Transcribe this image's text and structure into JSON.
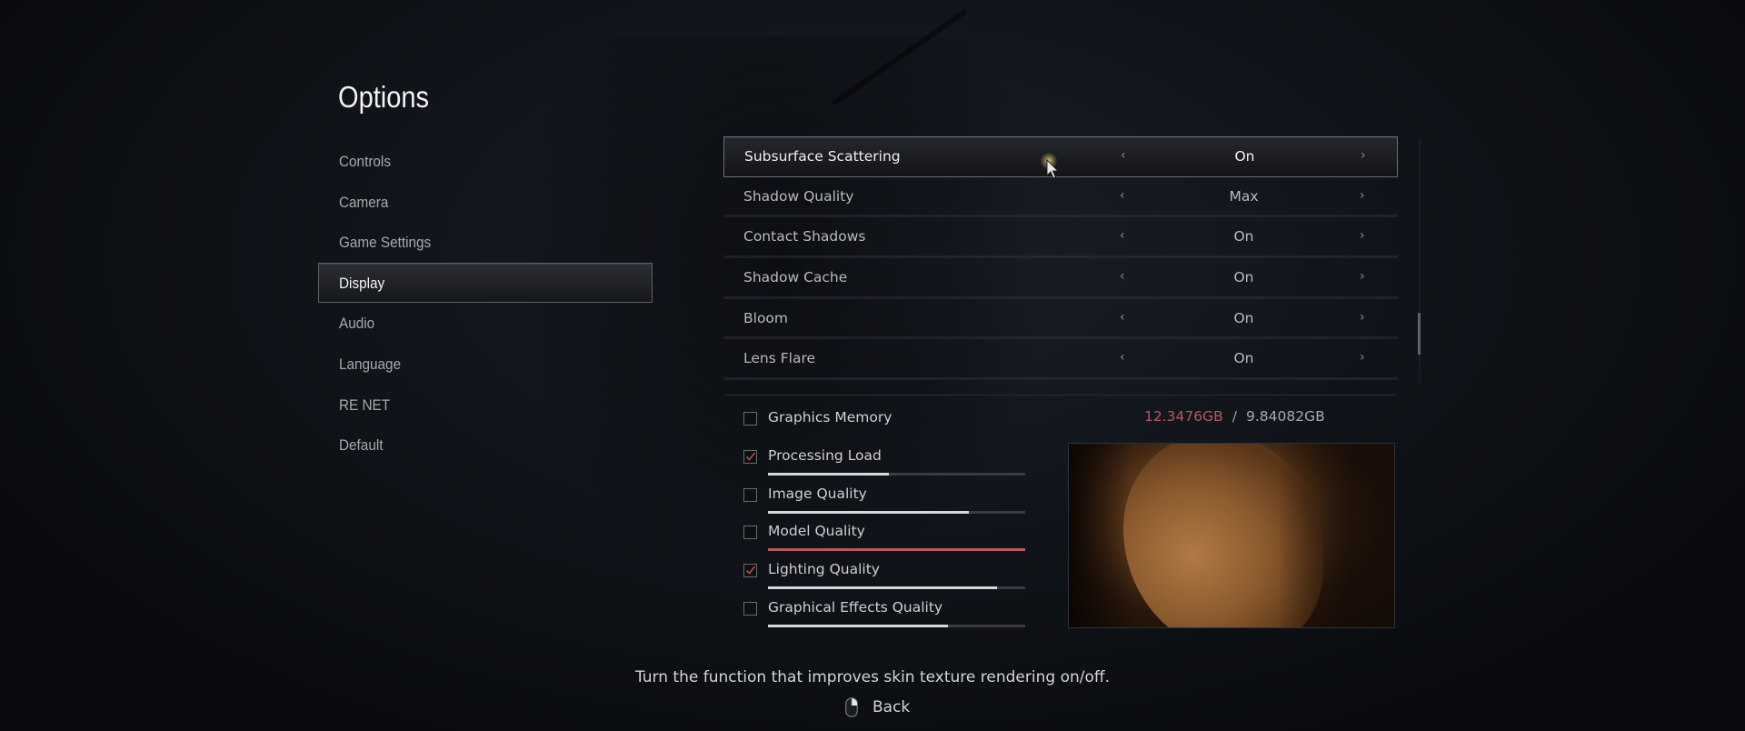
{
  "title": "Options",
  "nav": {
    "items": [
      {
        "label": "Controls",
        "active": false
      },
      {
        "label": "Camera",
        "active": false
      },
      {
        "label": "Game Settings",
        "active": false
      },
      {
        "label": "Display",
        "active": true
      },
      {
        "label": "Audio",
        "active": false
      },
      {
        "label": "Language",
        "active": false
      },
      {
        "label": "RE NET",
        "active": false
      },
      {
        "label": "Default",
        "active": false
      }
    ]
  },
  "settings": [
    {
      "label": "Subsurface Scattering",
      "value": "On",
      "active": true
    },
    {
      "label": "Shadow Quality",
      "value": "Max",
      "active": false
    },
    {
      "label": "Contact Shadows",
      "value": "On",
      "active": false
    },
    {
      "label": "Shadow Cache",
      "value": "On",
      "active": false
    },
    {
      "label": "Bloom",
      "value": "On",
      "active": false
    },
    {
      "label": "Lens Flare",
      "value": "On",
      "active": false
    }
  ],
  "scrollbar": {
    "position_fraction": 0.72
  },
  "graphics_memory": {
    "label": "Graphics Memory",
    "checked": false,
    "used": "12.3476GB",
    "separator": "/",
    "total": "9.84082GB",
    "used_color": "#b5595c"
  },
  "budget_meters": [
    {
      "label": "Processing Load",
      "checked": true,
      "fill_percent": 47,
      "over_limit": false
    },
    {
      "label": "Image Quality",
      "checked": false,
      "fill_percent": 78,
      "over_limit": false
    },
    {
      "label": "Model Quality",
      "checked": false,
      "fill_percent": 100,
      "over_limit": true
    },
    {
      "label": "Lighting Quality",
      "checked": true,
      "fill_percent": 89,
      "over_limit": false
    },
    {
      "label": "Graphical Effects Quality",
      "checked": false,
      "fill_percent": 70,
      "over_limit": false
    }
  ],
  "colors": {
    "accent_red": "#b85a5e",
    "bar_normal": "#d8d8d8",
    "check_red": "#c0474c"
  },
  "description": "Turn the function that improves skin texture rendering on/off.",
  "back": {
    "icon": "mouse-right-click-icon",
    "label": "Back"
  }
}
